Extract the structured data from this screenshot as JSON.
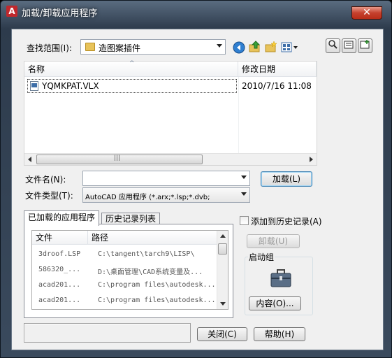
{
  "window": {
    "app_icon": "A",
    "title": "加载/卸载应用程序",
    "close_glyph": "✕"
  },
  "lookin": {
    "label": "查找范围(I):",
    "value": "造图案插件"
  },
  "toolbar_icons": [
    "back-icon",
    "up-folder-icon",
    "new-folder-icon",
    "views-icon"
  ],
  "side_icons": [
    "find-icon",
    "locations-icon",
    "add-location-icon"
  ],
  "file_list": {
    "columns": [
      "名称",
      "修改日期"
    ],
    "rows": [
      {
        "name": "YQMKPAT.VLX",
        "date": "2010/7/16 11:08"
      }
    ],
    "scroll_left": "◀",
    "scroll_right": "▶",
    "grip": "|||"
  },
  "filename": {
    "label": "文件名(N):",
    "value": ""
  },
  "filetype": {
    "label": "文件类型(T):",
    "value": "AutoCAD 应用程序 (*.arx;*.lsp;*.dvb;"
  },
  "buttons": {
    "load": "加载(L)",
    "unload": "卸载(U)",
    "contents": "内容(O)...",
    "close": "关闭(C)",
    "help": "帮助(H)"
  },
  "tabs": [
    "已加载的应用程序",
    "历史记录列表"
  ],
  "loaded_apps": {
    "columns": [
      "文件",
      "路径"
    ],
    "rows": [
      {
        "file": "3droof.LSP",
        "path": "C:\\tangent\\tarch9\\LISP\\"
      },
      {
        "file": "586320_...",
        "path": "D:\\桌面管理\\CAD系统变量及..."
      },
      {
        "file": "acad201...",
        "path": "C:\\program files\\autodesk..."
      },
      {
        "file": "acad201...",
        "path": "C:\\program files\\autodesk..."
      }
    ]
  },
  "add_history": {
    "label": "添加到历史记录(A)",
    "checked": false
  },
  "startup_group": {
    "label": "启动组",
    "icon": "briefcase-icon"
  },
  "status_text": ""
}
